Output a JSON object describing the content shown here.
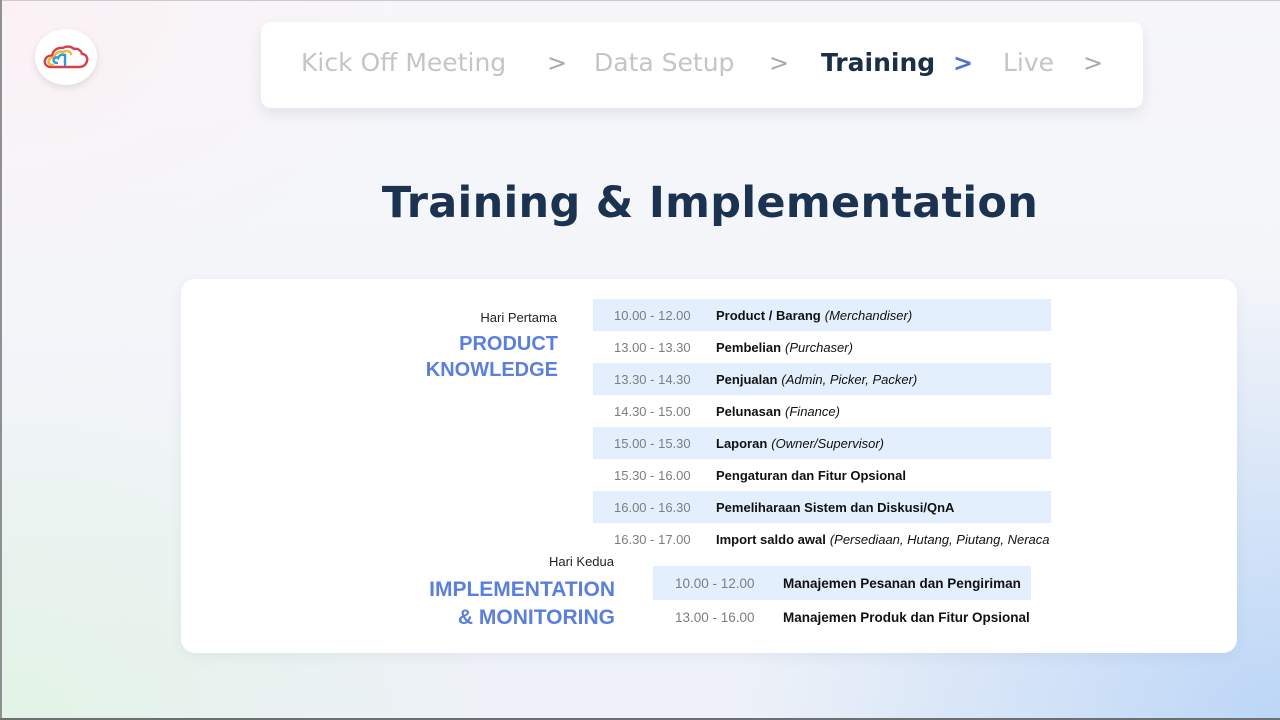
{
  "stepper": {
    "steps": [
      {
        "label": "Kick Off Meeting"
      },
      {
        "label": "Data Setup"
      },
      {
        "label": "Training"
      },
      {
        "label": "Live"
      }
    ],
    "chevron": ">"
  },
  "title": "Training & Implementation",
  "day1": {
    "label": "Hari Pertama",
    "title_line1": "PRODUCT",
    "title_line2": "KNOWLEDGE",
    "rows": [
      {
        "time": "10.00 - 12.00",
        "topic": "Product / Barang",
        "role": "(Merchandiser)"
      },
      {
        "time": "13.00 - 13.30",
        "topic": "Pembelian",
        "role": "(Purchaser)"
      },
      {
        "time": "13.30 - 14.30",
        "topic": "Penjualan",
        "role": "(Admin, Picker, Packer)"
      },
      {
        "time": "14.30 - 15.00",
        "topic": "Pelunasan",
        "role": "(Finance)"
      },
      {
        "time": "15.00 - 15.30",
        "topic": "Laporan",
        "role": "(Owner/Supervisor)"
      },
      {
        "time": "15.30 - 16.00",
        "topic": "Pengaturan dan Fitur Opsional",
        "role": ""
      },
      {
        "time": "16.00 - 16.30",
        "topic": "Pemeliharaan Sistem dan Diskusi/QnA",
        "role": ""
      },
      {
        "time": "16.30 - 17.00",
        "topic": "Import saldo awal",
        "role": "(Persediaan, Hutang, Piutang, Neraca"
      }
    ]
  },
  "day2": {
    "label": "Hari Kedua",
    "title_line1": "IMPLEMENTATION",
    "title_line2": "& MONITORING",
    "rows": [
      {
        "time": "10.00 - 12.00",
        "topic": "Manajemen Pesanan dan Pengiriman"
      },
      {
        "time": "13.00 - 16.00",
        "topic": "Manajemen Produk dan Fitur Opsional"
      }
    ]
  },
  "colors": {
    "accent": "#5a7fde",
    "title": "#1b3350",
    "row_shade": "#e3effc",
    "active_chevron": "#4f74d8"
  },
  "icons": {
    "logo": "cloud-logo-icon",
    "chevron": "chevron-right-icon"
  }
}
